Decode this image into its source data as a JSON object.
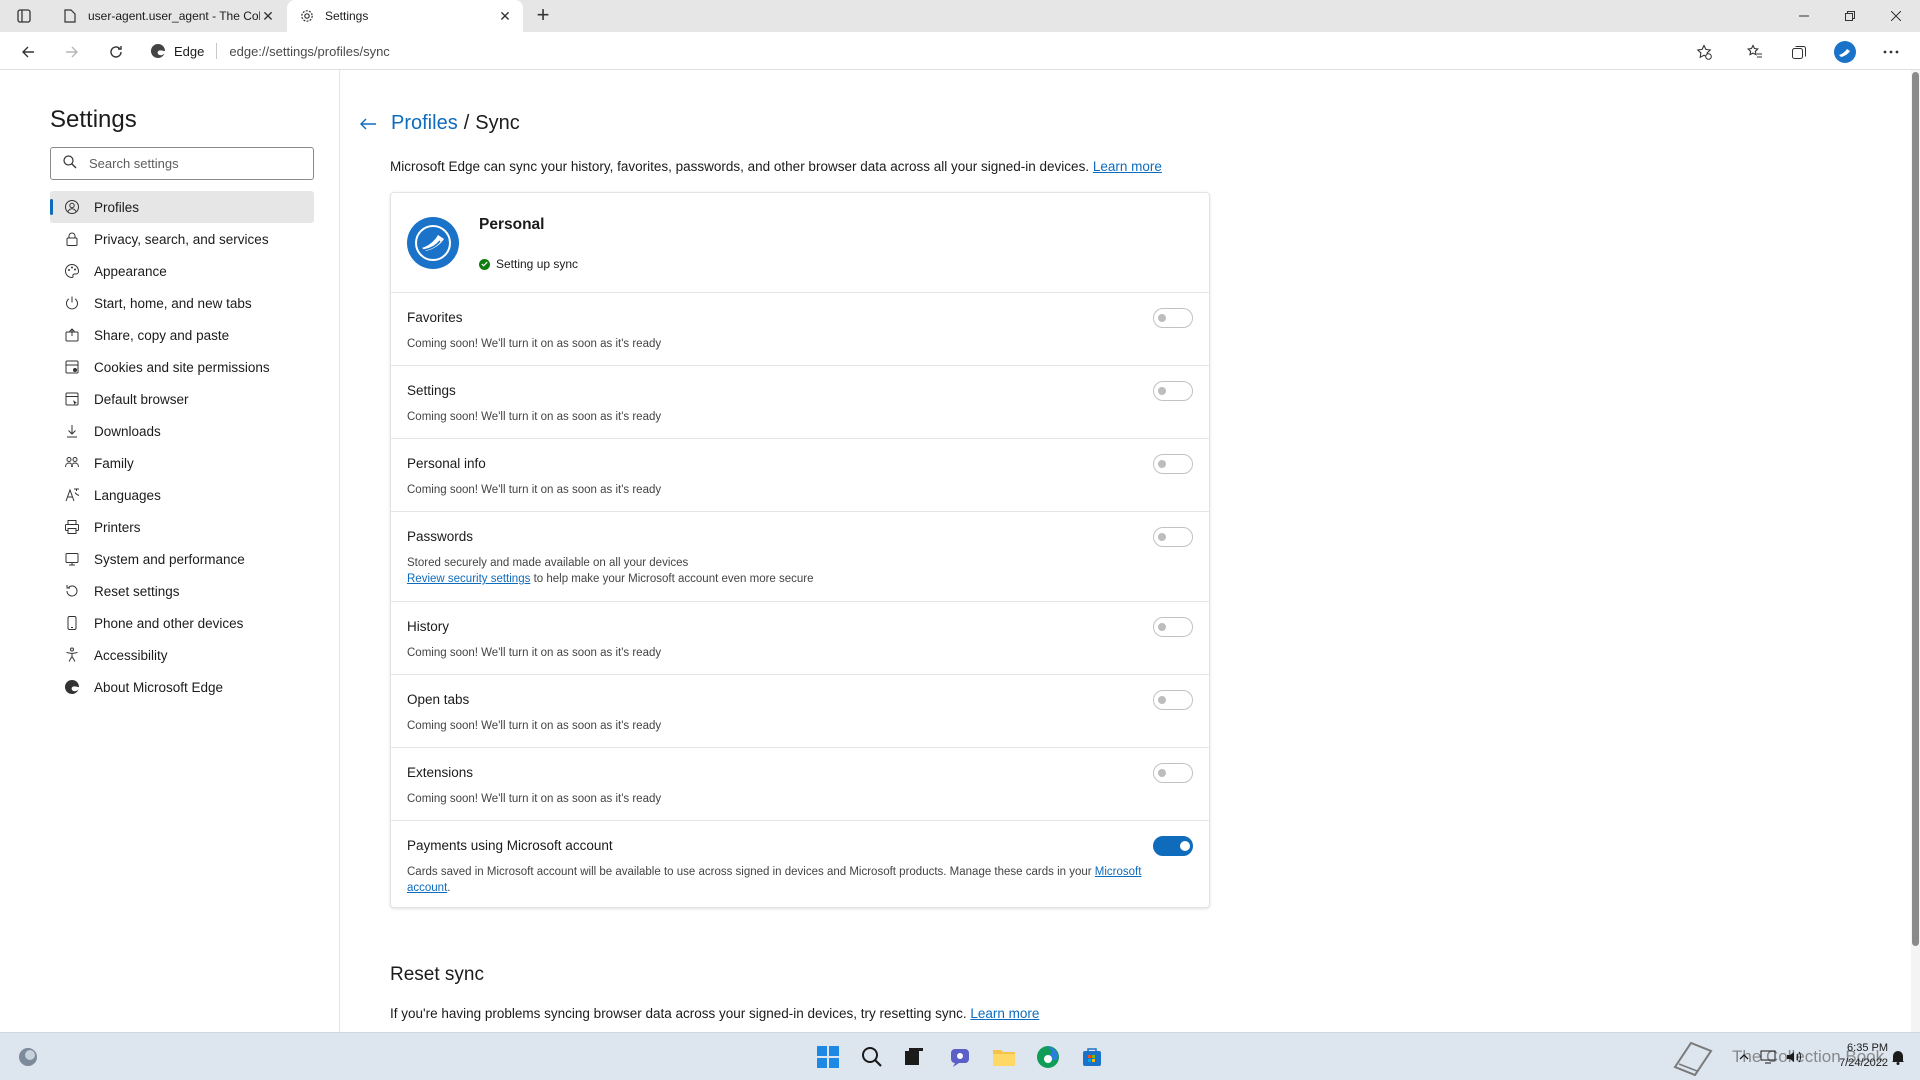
{
  "browser": {
    "tabs": [
      {
        "title": "user-agent.user_agent - The Coll",
        "active": false
      },
      {
        "title": "Settings",
        "active": true
      }
    ],
    "address": {
      "site": "Edge",
      "url": "edge://settings/profiles/sync"
    }
  },
  "sidebar": {
    "title": "Settings",
    "search_placeholder": "Search settings",
    "items": [
      {
        "label": "Profiles",
        "icon": "profile-icon",
        "active": true
      },
      {
        "label": "Privacy, search, and services",
        "icon": "lock-icon"
      },
      {
        "label": "Appearance",
        "icon": "palette-icon"
      },
      {
        "label": "Start, home, and new tabs",
        "icon": "power-icon"
      },
      {
        "label": "Share, copy and paste",
        "icon": "share-icon"
      },
      {
        "label": "Cookies and site permissions",
        "icon": "permissions-icon"
      },
      {
        "label": "Default browser",
        "icon": "browser-icon"
      },
      {
        "label": "Downloads",
        "icon": "download-icon"
      },
      {
        "label": "Family",
        "icon": "family-icon"
      },
      {
        "label": "Languages",
        "icon": "language-icon"
      },
      {
        "label": "Printers",
        "icon": "printer-icon"
      },
      {
        "label": "System and performance",
        "icon": "system-icon"
      },
      {
        "label": "Reset settings",
        "icon": "reset-icon"
      },
      {
        "label": "Phone and other devices",
        "icon": "phone-icon"
      },
      {
        "label": "Accessibility",
        "icon": "accessibility-icon"
      },
      {
        "label": "About Microsoft Edge",
        "icon": "edge-icon"
      }
    ]
  },
  "main": {
    "breadcrumb_parent": "Profiles",
    "breadcrumb_separator": "/",
    "breadcrumb_current": "Sync",
    "intro_text": "Microsoft Edge can sync your history, favorites, passwords, and other browser data across all your signed-in devices.",
    "intro_link": "Learn more",
    "profile": {
      "name": "Personal",
      "status": "Setting up sync"
    },
    "sync_items": [
      {
        "title": "Favorites",
        "desc": "Coming soon! We'll turn it on as soon as it's ready",
        "on": false
      },
      {
        "title": "Settings",
        "desc": "Coming soon! We'll turn it on as soon as it's ready",
        "on": false
      },
      {
        "title": "Personal info",
        "desc": "Coming soon! We'll turn it on as soon as it's ready",
        "on": false
      },
      {
        "title": "Passwords",
        "desc": "Stored securely and made available on all your devices",
        "link": "Review security settings",
        "link_suffix": "to help make your Microsoft account even more secure",
        "on": false
      },
      {
        "title": "History",
        "desc": "Coming soon! We'll turn it on as soon as it's ready",
        "on": false
      },
      {
        "title": "Open tabs",
        "desc": "Coming soon! We'll turn it on as soon as it's ready",
        "on": false
      },
      {
        "title": "Extensions",
        "desc": "Coming soon! We'll turn it on as soon as it's ready",
        "on": false
      },
      {
        "title": "Payments using Microsoft account",
        "desc": "Cards saved in Microsoft account will be available to use across signed in devices and Microsoft products. Manage these cards in your",
        "link": "Microsoft account",
        "link_suffix": ".",
        "on": true
      }
    ],
    "reset": {
      "title": "Reset sync",
      "desc": "If you're having problems syncing browser data across your signed-in devices, try resetting sync.",
      "link": "Learn more"
    }
  },
  "taskbar": {
    "time": "6:35 PM",
    "date": "7/24/2022",
    "watermark": "The Collection Book"
  },
  "colors": {
    "accent": "#0f6cbd",
    "status_green": "#107c10"
  }
}
